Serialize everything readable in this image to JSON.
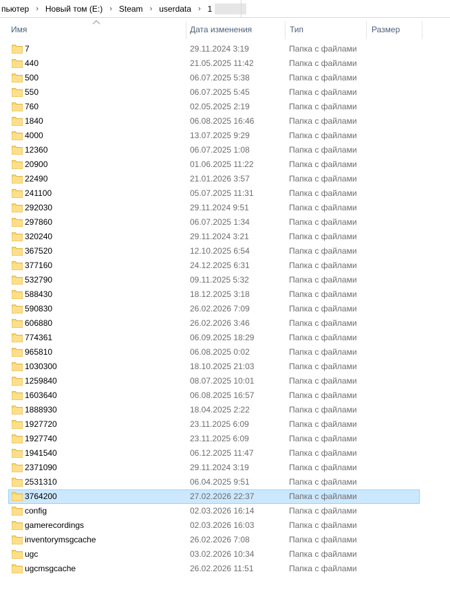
{
  "breadcrumb": [
    "пьютер",
    "Новый том (E:)",
    "Steam",
    "userdata",
    "1"
  ],
  "columns": {
    "name": "Имя",
    "date": "Дата изменения",
    "type": "Тип",
    "size": "Размер"
  },
  "files": [
    {
      "name": "7",
      "date": "29.11.2024 3:19",
      "type": "Папка с файлами"
    },
    {
      "name": "440",
      "date": "21.05.2025 11:42",
      "type": "Папка с файлами"
    },
    {
      "name": "500",
      "date": "06.07.2025 5:38",
      "type": "Папка с файлами"
    },
    {
      "name": "550",
      "date": "06.07.2025 5:45",
      "type": "Папка с файлами"
    },
    {
      "name": "760",
      "date": "02.05.2025 2:19",
      "type": "Папка с файлами"
    },
    {
      "name": "1840",
      "date": "06.08.2025 16:46",
      "type": "Папка с файлами"
    },
    {
      "name": "4000",
      "date": "13.07.2025 9:29",
      "type": "Папка с файлами"
    },
    {
      "name": "12360",
      "date": "06.07.2025 1:08",
      "type": "Папка с файлами"
    },
    {
      "name": "20900",
      "date": "01.06.2025 11:22",
      "type": "Папка с файлами"
    },
    {
      "name": "22490",
      "date": "21.01.2026 3:57",
      "type": "Папка с файлами"
    },
    {
      "name": "241100",
      "date": "05.07.2025 11:31",
      "type": "Папка с файлами"
    },
    {
      "name": "292030",
      "date": "29.11.2024 9:51",
      "type": "Папка с файлами"
    },
    {
      "name": "297860",
      "date": "06.07.2025 1:34",
      "type": "Папка с файлами"
    },
    {
      "name": "320240",
      "date": "29.11.2024 3:21",
      "type": "Папка с файлами"
    },
    {
      "name": "367520",
      "date": "12.10.2025 6:54",
      "type": "Папка с файлами"
    },
    {
      "name": "377160",
      "date": "24.12.2025 6:31",
      "type": "Папка с файлами"
    },
    {
      "name": "532790",
      "date": "09.11.2025 5:32",
      "type": "Папка с файлами"
    },
    {
      "name": "588430",
      "date": "18.12.2025 3:18",
      "type": "Папка с файлами"
    },
    {
      "name": "590830",
      "date": "26.02.2026 7:09",
      "type": "Папка с файлами"
    },
    {
      "name": "606880",
      "date": "26.02.2026 3:46",
      "type": "Папка с файлами"
    },
    {
      "name": "774361",
      "date": "06.09.2025 18:29",
      "type": "Папка с файлами"
    },
    {
      "name": "965810",
      "date": "06.08.2025 0:02",
      "type": "Папка с файлами"
    },
    {
      "name": "1030300",
      "date": "18.10.2025 21:03",
      "type": "Папка с файлами"
    },
    {
      "name": "1259840",
      "date": "08.07.2025 10:01",
      "type": "Папка с файлами"
    },
    {
      "name": "1603640",
      "date": "06.08.2025 16:57",
      "type": "Папка с файлами"
    },
    {
      "name": "1888930",
      "date": "18.04.2025 2:22",
      "type": "Папка с файлами"
    },
    {
      "name": "1927720",
      "date": "23.11.2025 6:09",
      "type": "Папка с файлами"
    },
    {
      "name": "1927740",
      "date": "23.11.2025 6:09",
      "type": "Папка с файлами"
    },
    {
      "name": "1941540",
      "date": "06.12.2025 11:47",
      "type": "Папка с файлами"
    },
    {
      "name": "2371090",
      "date": "29.11.2024 3:19",
      "type": "Папка с файлами"
    },
    {
      "name": "2531310",
      "date": "06.04.2025 9:51",
      "type": "Папка с файлами"
    },
    {
      "name": "3764200",
      "date": "27.02.2026 22:37",
      "type": "Папка с файлами",
      "selected": true
    },
    {
      "name": "config",
      "date": "02.03.2026 16:14",
      "type": "Папка с файлами"
    },
    {
      "name": "gamerecordings",
      "date": "02.03.2026 16:03",
      "type": "Папка с файлами"
    },
    {
      "name": "inventorymsgcache",
      "date": "26.02.2026 7:08",
      "type": "Папка с файлами"
    },
    {
      "name": "ugc",
      "date": "03.02.2026 10:34",
      "type": "Папка с файлами"
    },
    {
      "name": "ugcmsgcache",
      "date": "26.02.2026 11:51",
      "type": "Папка с файлами"
    }
  ],
  "icons": {
    "folder": "folder-icon",
    "sort": "sort-ascending-icon",
    "separator": "chevron-right-icon"
  },
  "colors": {
    "selection_bg": "#cce8ff",
    "selection_border": "#99d1ff",
    "folder": "#ffd86a",
    "header_text": "#4c607a"
  }
}
